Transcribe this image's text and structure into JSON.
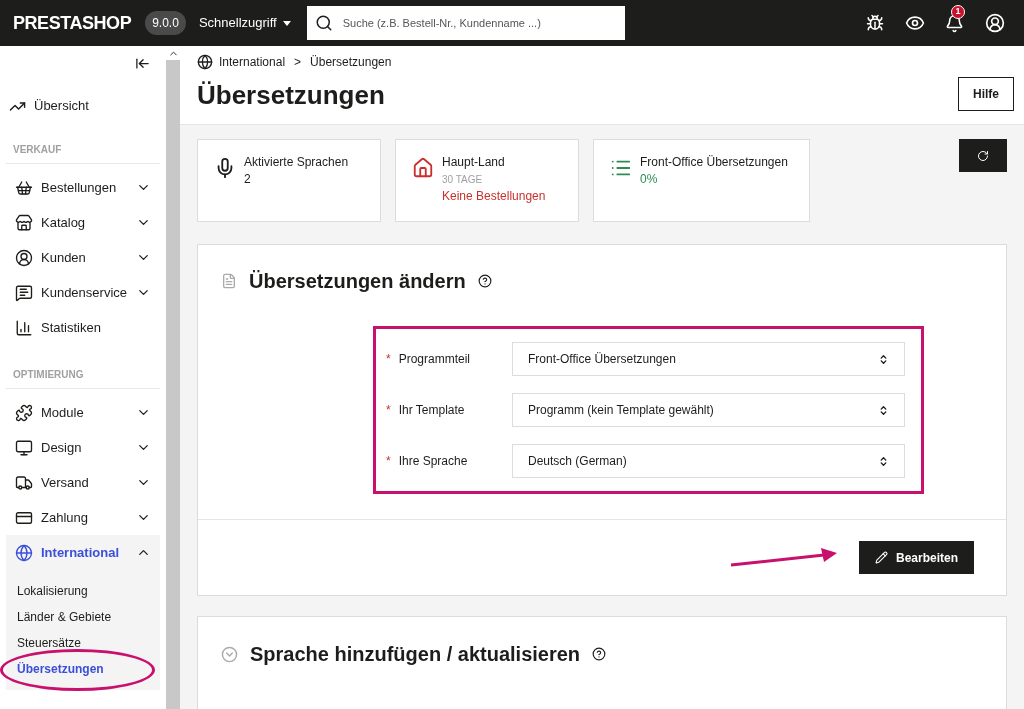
{
  "topbar": {
    "logo": "PRESTASHOP",
    "version": "9.0.0",
    "quick_access": "Schnellzugriff",
    "search": {
      "placeholder": "Suche (z.B. Bestell-Nr., Kundenname ...)"
    },
    "notification_count": "1"
  },
  "sidebar": {
    "top_item": {
      "label": "Übersicht",
      "selected": false
    },
    "sections": [
      {
        "title": "VERKAUF",
        "items": [
          {
            "label": "Bestellungen",
            "expandable": true,
            "expanded": false,
            "selected": false
          },
          {
            "label": "Katalog",
            "expandable": true,
            "expanded": false,
            "selected": false
          },
          {
            "label": "Kunden",
            "expandable": true,
            "expanded": false,
            "selected": false
          },
          {
            "label": "Kundenservice",
            "expandable": true,
            "expanded": false,
            "selected": false
          },
          {
            "label": "Statistiken",
            "expandable": false,
            "selected": false
          }
        ]
      },
      {
        "title": "OPTIMIERUNG",
        "items": [
          {
            "label": "Module",
            "expandable": true,
            "expanded": false,
            "selected": false
          },
          {
            "label": "Design",
            "expandable": true,
            "expanded": false,
            "selected": false
          },
          {
            "label": "Versand",
            "expandable": true,
            "expanded": false,
            "selected": false
          },
          {
            "label": "Zahlung",
            "expandable": true,
            "expanded": false,
            "selected": false
          },
          {
            "label": "International",
            "expandable": true,
            "expanded": true,
            "selected": true,
            "children": [
              {
                "label": "Lokalisierung",
                "selected": false
              },
              {
                "label": "Länder & Gebiete",
                "selected": false
              },
              {
                "label": "Steuersätze",
                "selected": false
              },
              {
                "label": "Übersetzungen",
                "selected": true
              }
            ]
          }
        ]
      }
    ]
  },
  "header": {
    "breadcrumb": [
      "International",
      ">",
      "Übersetzungen"
    ],
    "title": "Übersetzungen",
    "help_button": "Hilfe"
  },
  "kpis": [
    {
      "title": "Aktivierte Sprachen",
      "value": "2",
      "color": "#1d1d1b"
    },
    {
      "title": "Haupt-Land",
      "subtitle": "30 TAGE",
      "value": "Keine Bestellungen",
      "color": "#c9302c"
    },
    {
      "title": "Front-Office Übersetzungen",
      "value": "0%",
      "color": "#2e8b57"
    }
  ],
  "edit_panel": {
    "title": "Übersetzungen ändern",
    "fields": [
      {
        "label": "Programmteil",
        "required_mark": "*",
        "value": "Front-Office Übersetzungen"
      },
      {
        "label": "Ihr Template",
        "required_mark": "*",
        "value": "Programm (kein Template gewählt)"
      },
      {
        "label": "Ihre Sprache",
        "required_mark": "*",
        "value": "Deutsch (German)"
      }
    ],
    "button": "Bearbeiten"
  },
  "add_panel": {
    "title": "Sprache hinzufügen / aktualisieren"
  }
}
